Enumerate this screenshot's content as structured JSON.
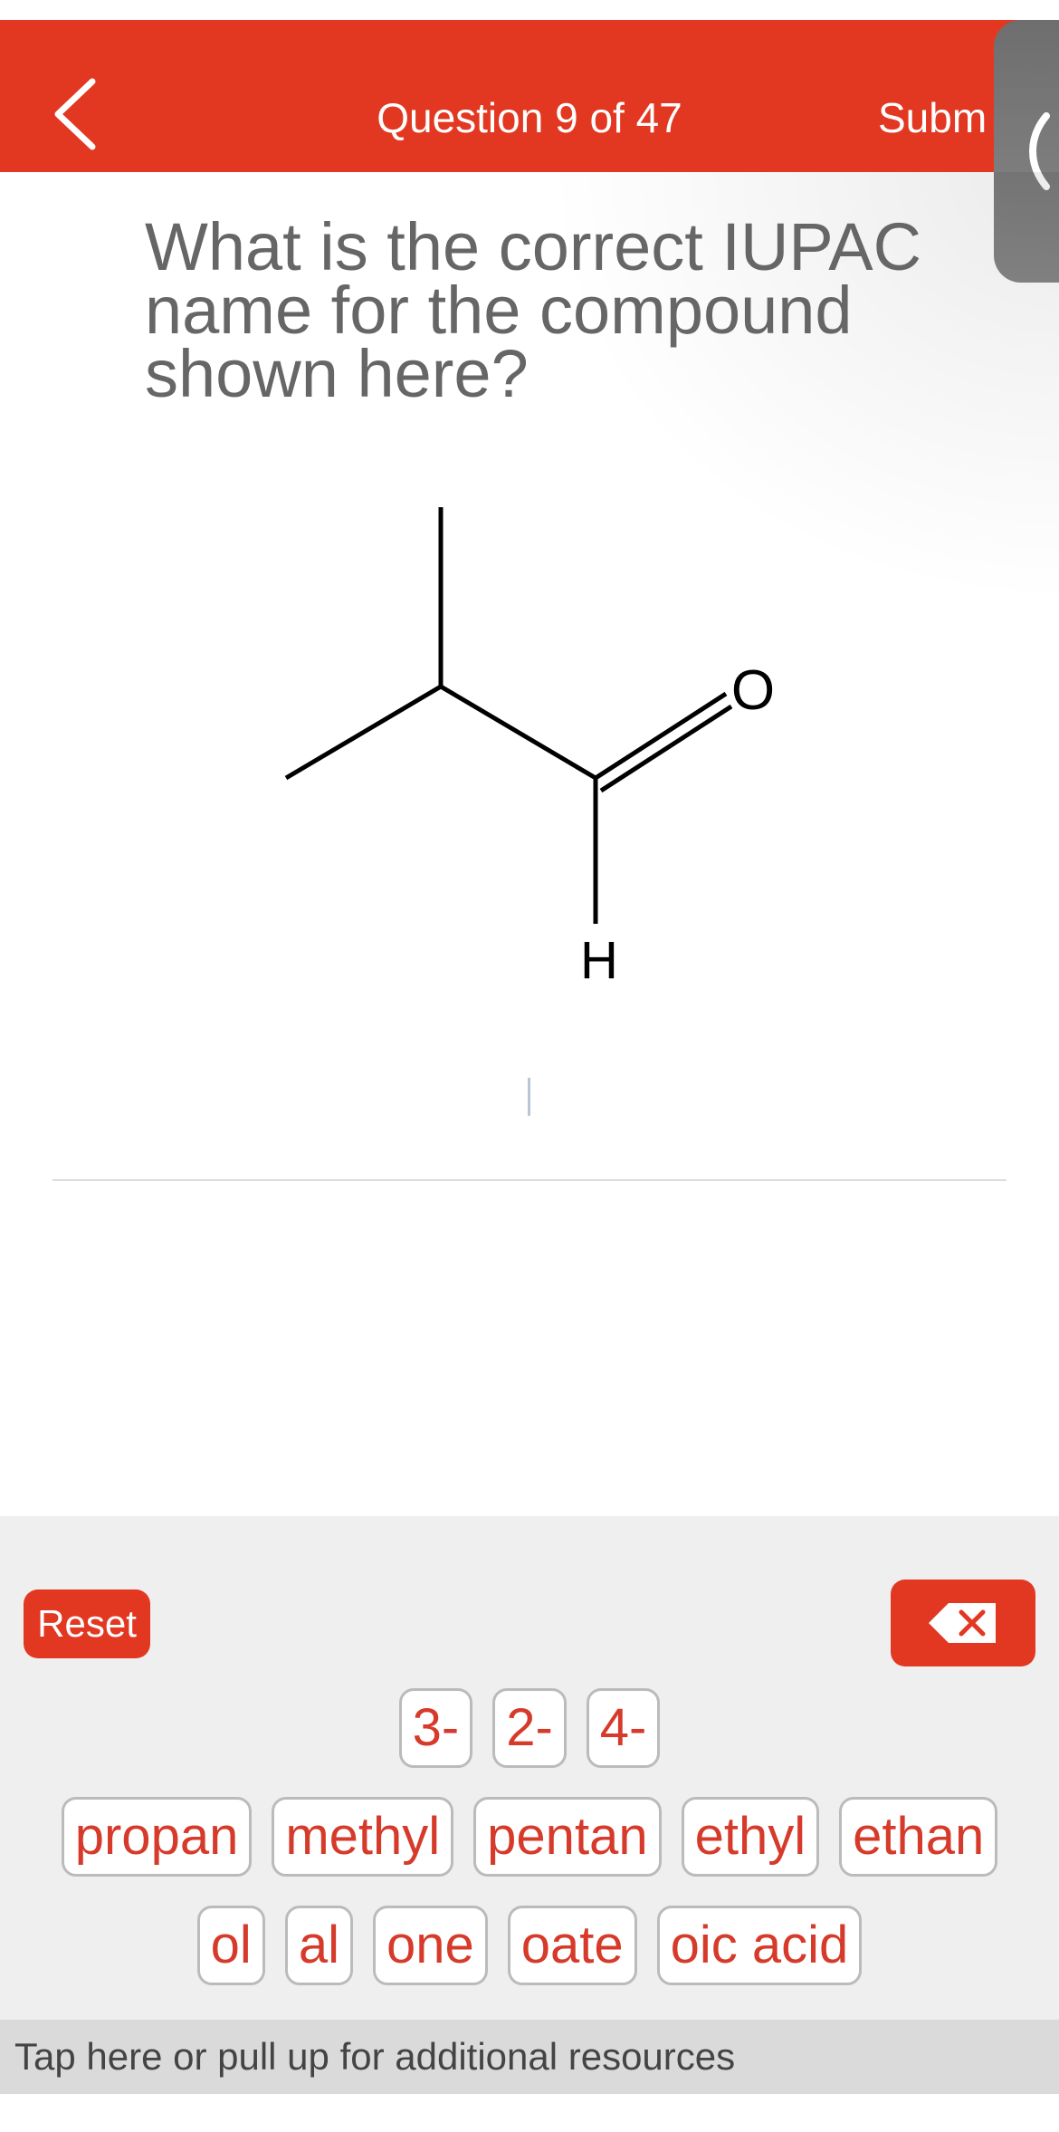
{
  "header": {
    "title": "Question 9 of 47",
    "submit_label": "Subm"
  },
  "question": {
    "text": "What is the correct IUPAC name for the compound shown here?"
  },
  "molecule": {
    "atom_labels": {
      "oxygen": "O",
      "hydrogen": "H"
    }
  },
  "tray": {
    "reset_label": "Reset",
    "delete_icon": "backspace-icon",
    "row1": [
      "3-",
      "2-",
      "4-"
    ],
    "row2": [
      "propan",
      "methyl",
      "pentan",
      "ethyl",
      "ethan"
    ],
    "row3": [
      "ol",
      "al",
      "one",
      "oate",
      "oic acid"
    ]
  },
  "resources": {
    "text": "Tap here or pull up for additional resources"
  },
  "colors": {
    "accent": "#e23822",
    "tile_text": "#d63a2a",
    "tray_background": "#efefef"
  }
}
